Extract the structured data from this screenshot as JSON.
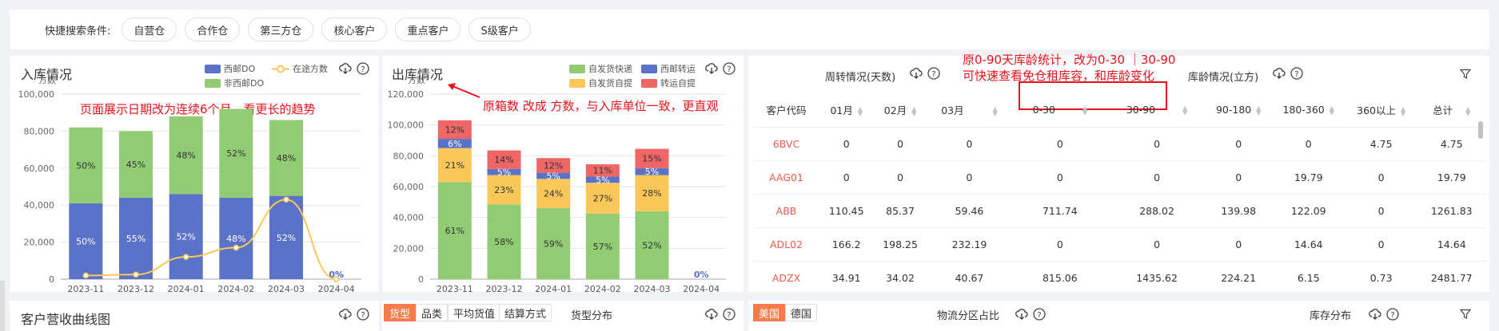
{
  "filter_bar": {
    "label": "快捷搜索条件:",
    "chips": [
      "自营仓",
      "合作仓",
      "第三方仓",
      "核心客户",
      "重点客户",
      "S级客户"
    ]
  },
  "inbound": {
    "title": "入库情况",
    "legend": [
      "西邮DO",
      "在途方数",
      "非西邮DO"
    ],
    "annotation": "页面展示日期改为连续6个月，看更长的趋势",
    "unit": "方数",
    "colors": {
      "dc": "#5b72c9",
      "non": "#91cc75",
      "line": "#fac858"
    }
  },
  "outbound": {
    "title": "出库情况",
    "legend": [
      "自发货快递",
      "西邮转运",
      "自发货自提",
      "转运自提"
    ],
    "annotation": "原箱数 改成 方数，与入库单位一致，更直观",
    "unit": "方数"
  },
  "chart_data": [
    {
      "type": "bar",
      "title": "入库情况",
      "ylabel": "方数",
      "ylim": [
        0,
        100000
      ],
      "yticks": [
        "0",
        "20,000",
        "40,000",
        "60,000",
        "80,000",
        "100,000"
      ],
      "categories": [
        "2023-11",
        "2023-12",
        "2024-01",
        "2024-02",
        "2024-03",
        "2024-04"
      ],
      "stacked": true,
      "series": [
        {
          "name": "西邮DO",
          "values": [
            41000,
            44000,
            46000,
            44000,
            45000,
            0
          ],
          "labels": [
            "50%",
            "55%",
            "52%",
            "48%",
            "52%",
            "0%"
          ],
          "color": "#5b72c9"
        },
        {
          "name": "非西邮DO",
          "values": [
            41000,
            36000,
            42000,
            48000,
            41000,
            0
          ],
          "labels": [
            "50%",
            "45%",
            "48%",
            "52%",
            "48%",
            "0%"
          ],
          "color": "#91cc75"
        },
        {
          "name": "在途方数",
          "type": "line",
          "values": [
            2000,
            2500,
            12000,
            17000,
            43000,
            0
          ],
          "color": "#fac858"
        }
      ]
    },
    {
      "type": "bar",
      "title": "出库情况",
      "ylabel": "方数",
      "ylim": [
        0,
        120000
      ],
      "yticks": [
        "0",
        "20,000",
        "40,000",
        "60,000",
        "80,000",
        "100,000",
        "120,000"
      ],
      "categories": [
        "2023-11",
        "2023-12",
        "2024-01",
        "2024-02",
        "2024-03",
        "2024-04"
      ],
      "stacked": true,
      "series": [
        {
          "name": "自发货快递",
          "values": [
            63000,
            48500,
            46000,
            42500,
            44000,
            0
          ],
          "labels": [
            "61%",
            "58%",
            "59%",
            "57%",
            "52%",
            "0%"
          ],
          "color": "#91cc75"
        },
        {
          "name": "自发货自提",
          "values": [
            22000,
            19000,
            19000,
            20000,
            23500,
            0
          ],
          "labels": [
            "21%",
            "23%",
            "24%",
            "27%",
            "28%",
            ""
          ],
          "color": "#fac858"
        },
        {
          "name": "西邮转运",
          "values": [
            6000,
            4000,
            4000,
            4000,
            4500,
            0
          ],
          "labels": [
            "6%",
            "5%",
            "5%",
            "5%",
            "5%",
            ""
          ],
          "color": "#5b72c9"
        },
        {
          "name": "转运自提",
          "values": [
            12000,
            12000,
            9500,
            8000,
            12500,
            0
          ],
          "labels": [
            "12%",
            "14%",
            "12%",
            "11%",
            "15%",
            ""
          ],
          "color": "#ee6666"
        }
      ]
    }
  ],
  "turnover": {
    "title_days": "周转情况(天数)",
    "title_age": "库龄情况(立方)",
    "annotation_line1": "原0-90天库龄统计，改为0-30 ｜30-90",
    "annotation_line2": "可快速查看免仓租库容，和库龄变化",
    "columns": [
      "客户代码",
      "01月",
      "02月",
      "03月",
      "0-30",
      "30-90",
      "90-180",
      "180-360",
      "360以上",
      "总计"
    ],
    "rows": [
      [
        "6BVC",
        "0",
        "0",
        "0",
        "0",
        "0",
        "0",
        "0",
        "4.75",
        "4.75"
      ],
      [
        "AAG01",
        "0",
        "0",
        "0",
        "0",
        "0",
        "0",
        "19.79",
        "0",
        "19.79"
      ],
      [
        "ABB",
        "110.45",
        "85.37",
        "59.46",
        "711.74",
        "288.02",
        "139.98",
        "122.09",
        "0",
        "1261.83"
      ],
      [
        "ADL02",
        "166.2",
        "198.25",
        "232.19",
        "0",
        "0",
        "0",
        "14.64",
        "0",
        "14.64"
      ],
      [
        "ADZX",
        "34.91",
        "34.02",
        "40.67",
        "815.06",
        "1435.62",
        "224.21",
        "6.15",
        "0.73",
        "2481.77"
      ]
    ]
  },
  "bottom": {
    "revenue_title": "客户营收曲线图",
    "cargo_tabs": [
      "货型",
      "品类",
      "平均货值",
      "结算方式"
    ],
    "cargo_title": "货型分布",
    "region_tabs": [
      "美国",
      "德国"
    ],
    "logistics_title": "物流分区占比",
    "stock_title": "库存分布"
  }
}
